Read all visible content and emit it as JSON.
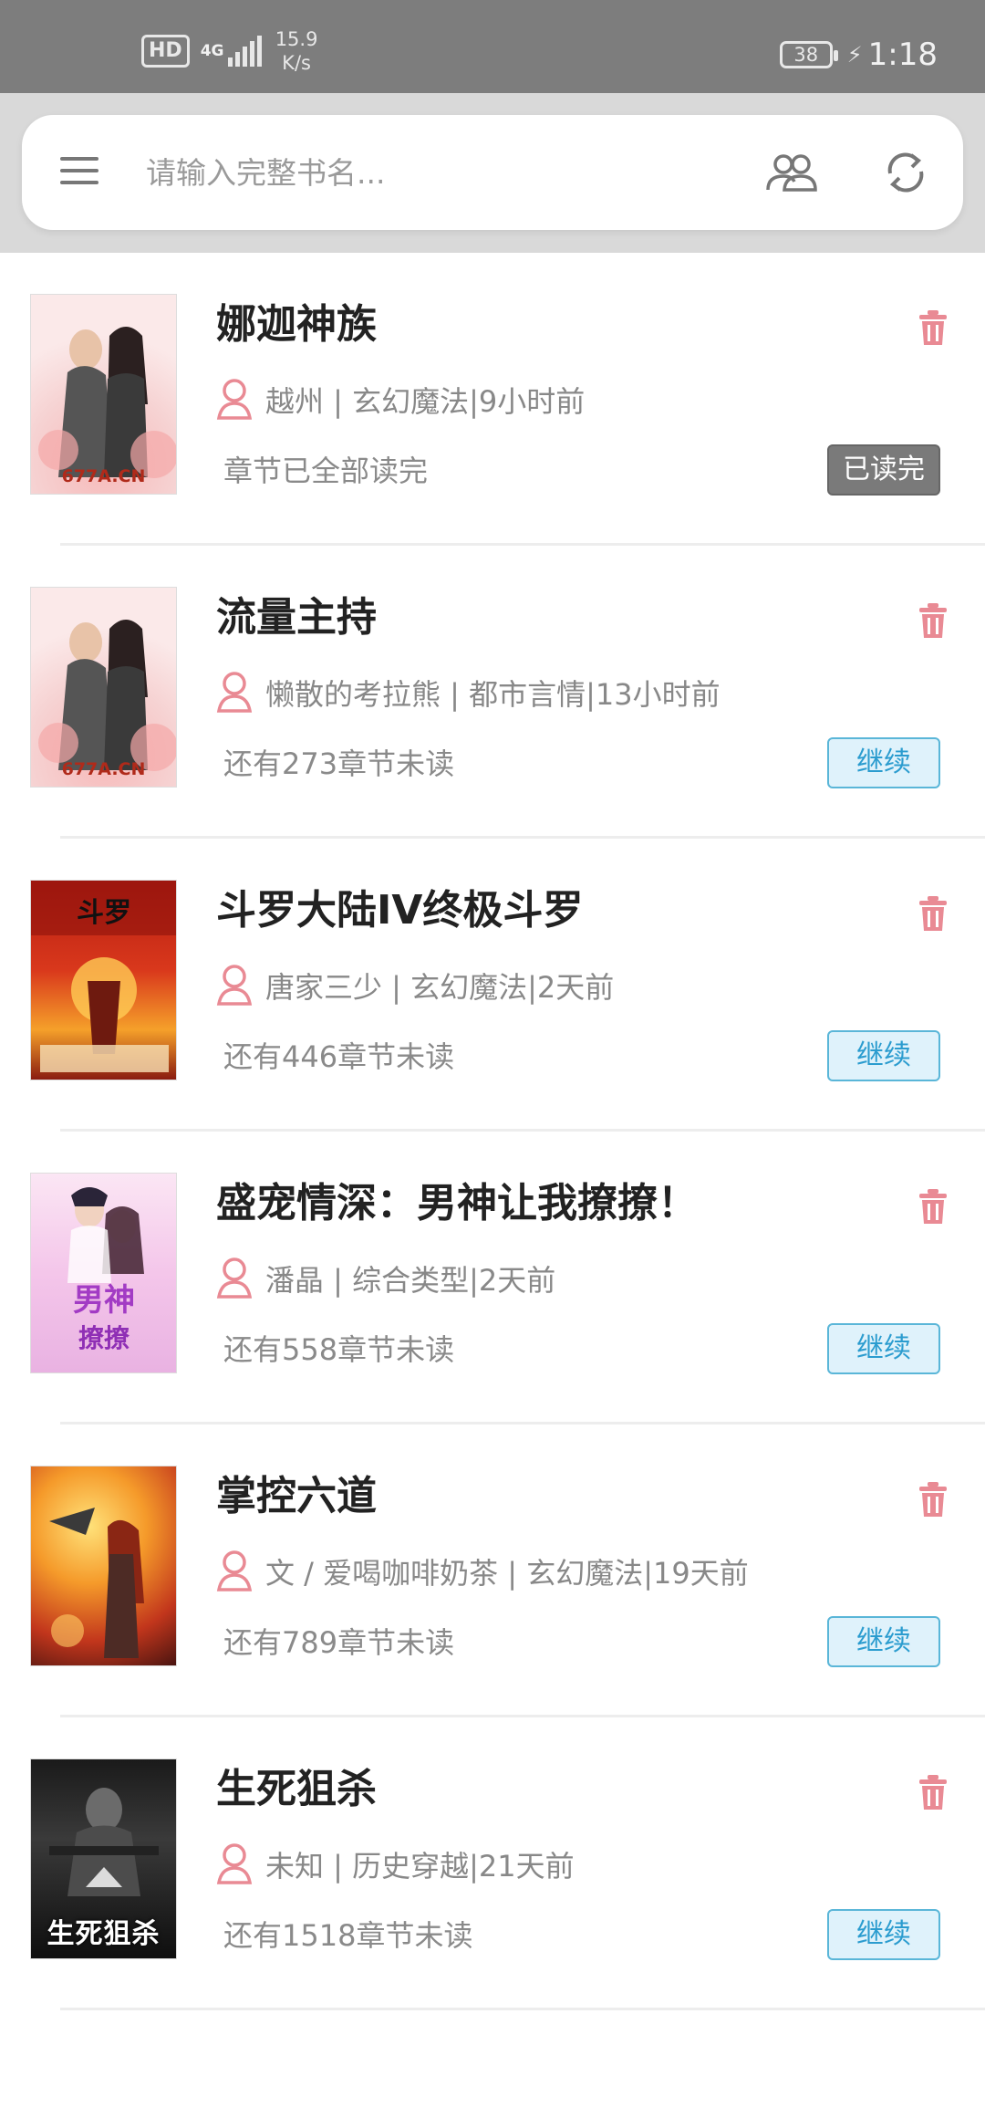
{
  "status_bar": {
    "hd_label": "HD",
    "network_type": "4G",
    "speed_value": "15.9",
    "speed_unit": "K/s",
    "battery_level": "38",
    "time": "1:18"
  },
  "search": {
    "placeholder": "请输入完整书名..."
  },
  "icons": {
    "menu": "menu-icon",
    "users": "users-icon",
    "sync": "sync-icon",
    "delete": "trash-icon",
    "author": "person-icon"
  },
  "colors": {
    "accent_pink": "#e98a94",
    "continue_bg": "#dff2fb",
    "continue_border": "#5ab6d8",
    "continue_text": "#2b9ccf",
    "done_bg": "#7a7a7a"
  },
  "books": [
    {
      "title": "娜迦神族",
      "meta": "越州 | 玄幻魔法|9小时前",
      "progress": "章节已全部读完",
      "action": "已读完",
      "cover_tag": "677A.CN",
      "cover_title": ""
    },
    {
      "title": "流量主持",
      "meta": "懒散的考拉熊 | 都市言情|13小时前",
      "progress": "还有273章节未读",
      "action": "继续",
      "cover_tag": "677A.CN",
      "cover_title": ""
    },
    {
      "title": "斗罗大陆IV终极斗罗",
      "meta": "唐家三少 | 玄幻魔法|2天前",
      "progress": "还有446章节未读",
      "action": "继续",
      "cover_tag": "",
      "cover_title": ""
    },
    {
      "title": "盛宠情深：男神让我撩撩！",
      "meta": "潘晶 | 综合类型|2天前",
      "progress": "还有558章节未读",
      "action": "继续",
      "cover_tag": "",
      "cover_title": ""
    },
    {
      "title": "掌控六道",
      "meta": "文 / 爱喝咖啡奶茶 | 玄幻魔法|19天前",
      "progress": "还有789章节未读",
      "action": "继续",
      "cover_tag": "",
      "cover_title": ""
    },
    {
      "title": "生死狙杀",
      "meta": "未知 | 历史穿越|21天前",
      "progress": "还有1518章节未读",
      "action": "继续",
      "cover_tag": "",
      "cover_title": "生死狙杀"
    }
  ]
}
